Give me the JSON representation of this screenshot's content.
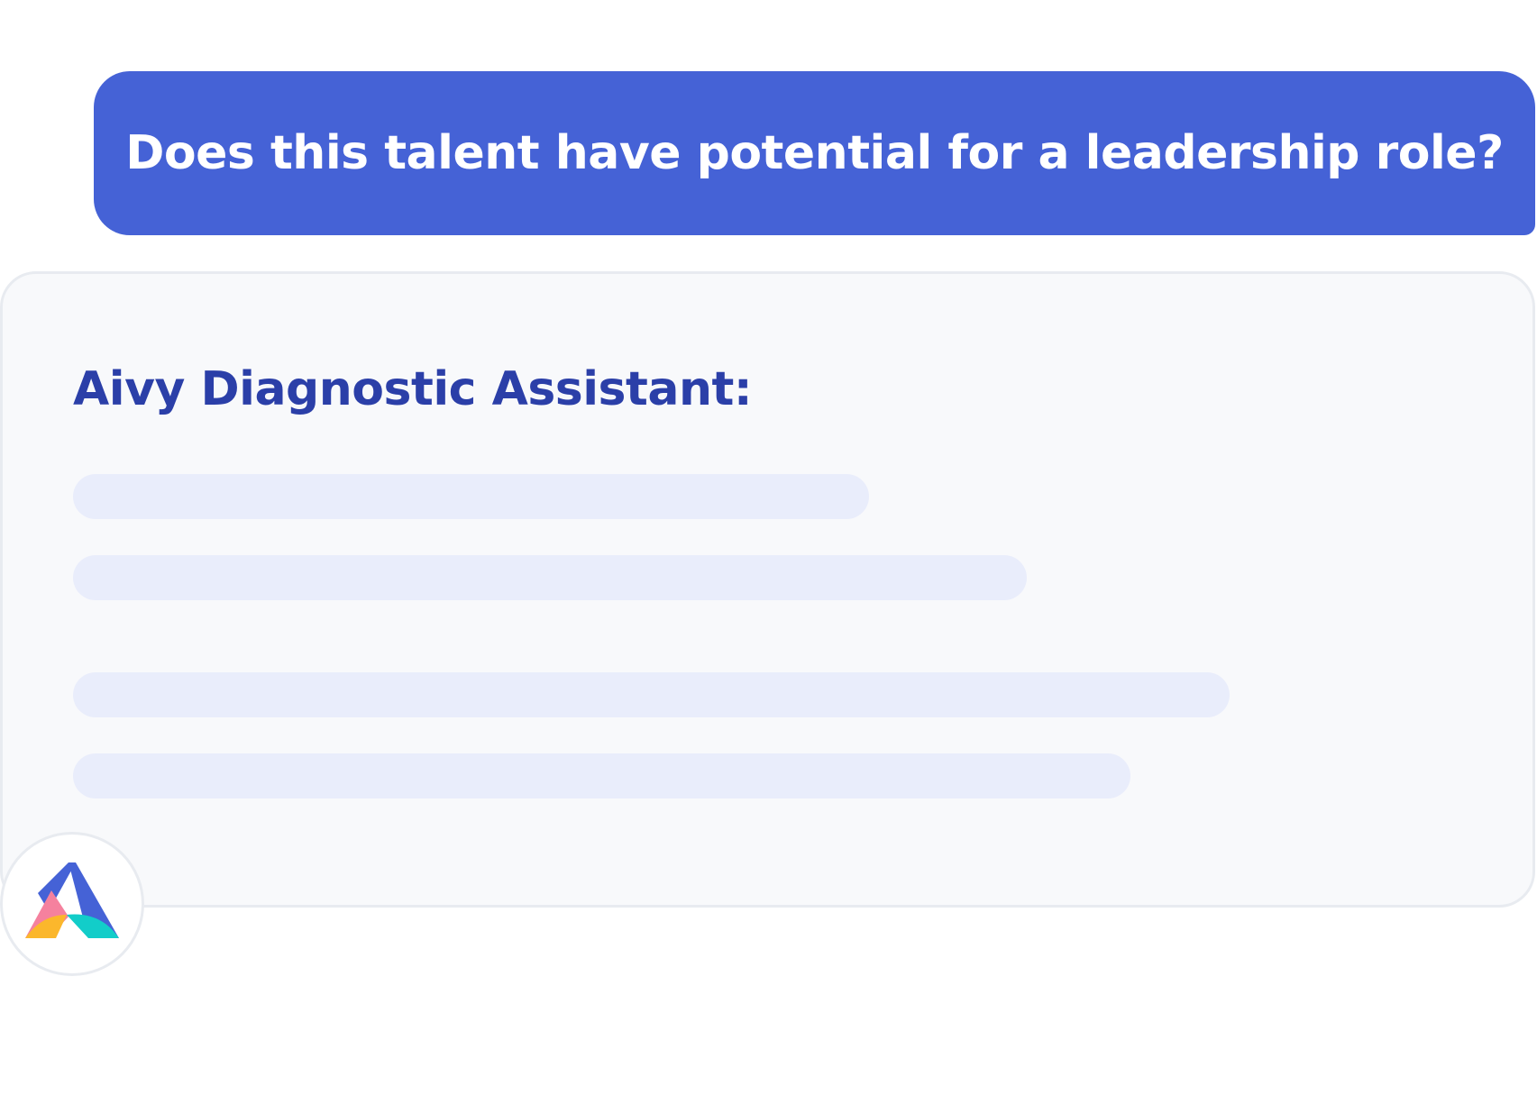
{
  "question": {
    "text": "Does this talent have potential for a leadership role?"
  },
  "answer_card": {
    "assistant_label": "Aivy Diagnostic Assistant:",
    "skeleton_lines": [
      "loading",
      "loading",
      "loading",
      "loading"
    ]
  },
  "avatar": {
    "icon": "aivy-logo-icon"
  },
  "colors": {
    "bubble": "#4562d6",
    "title": "#2b3fa8",
    "skeleton": "#e9edfb",
    "card_bg": "#f8f9fb",
    "logo_blue": "#4562d6",
    "logo_pink": "#f5819e",
    "logo_yellow": "#fbb72c",
    "logo_teal": "#12cdc9"
  }
}
